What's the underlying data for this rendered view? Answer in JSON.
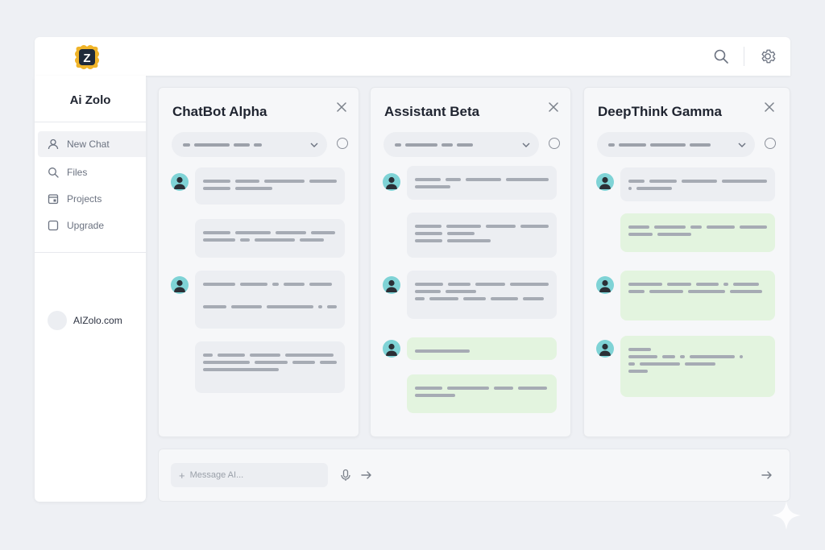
{
  "app": {
    "name": "Ai Zolo",
    "logo_letter": "Z"
  },
  "topbar": {
    "search_icon": "search-icon",
    "settings_icon": "gear-icon"
  },
  "sidebar": {
    "items": [
      {
        "label": "New Chat",
        "icon": "user-icon",
        "active": true
      },
      {
        "label": "Files",
        "icon": "search-icon",
        "active": false
      },
      {
        "label": "Projects",
        "icon": "calendar-icon",
        "active": false
      },
      {
        "label": "Upgrade",
        "icon": "square-icon",
        "active": false
      }
    ],
    "account": "AIZolo.com"
  },
  "panels": [
    {
      "title": "ChatBot Alpha"
    },
    {
      "title": "Assistant Beta"
    },
    {
      "title": "DeepThink Gamma"
    }
  ],
  "composer": {
    "placeholder": "Message AI..."
  },
  "colors": {
    "accent_green": "#e3f4df",
    "avatar": "#7fd3d6",
    "bubble_grey": "#eceef2"
  }
}
